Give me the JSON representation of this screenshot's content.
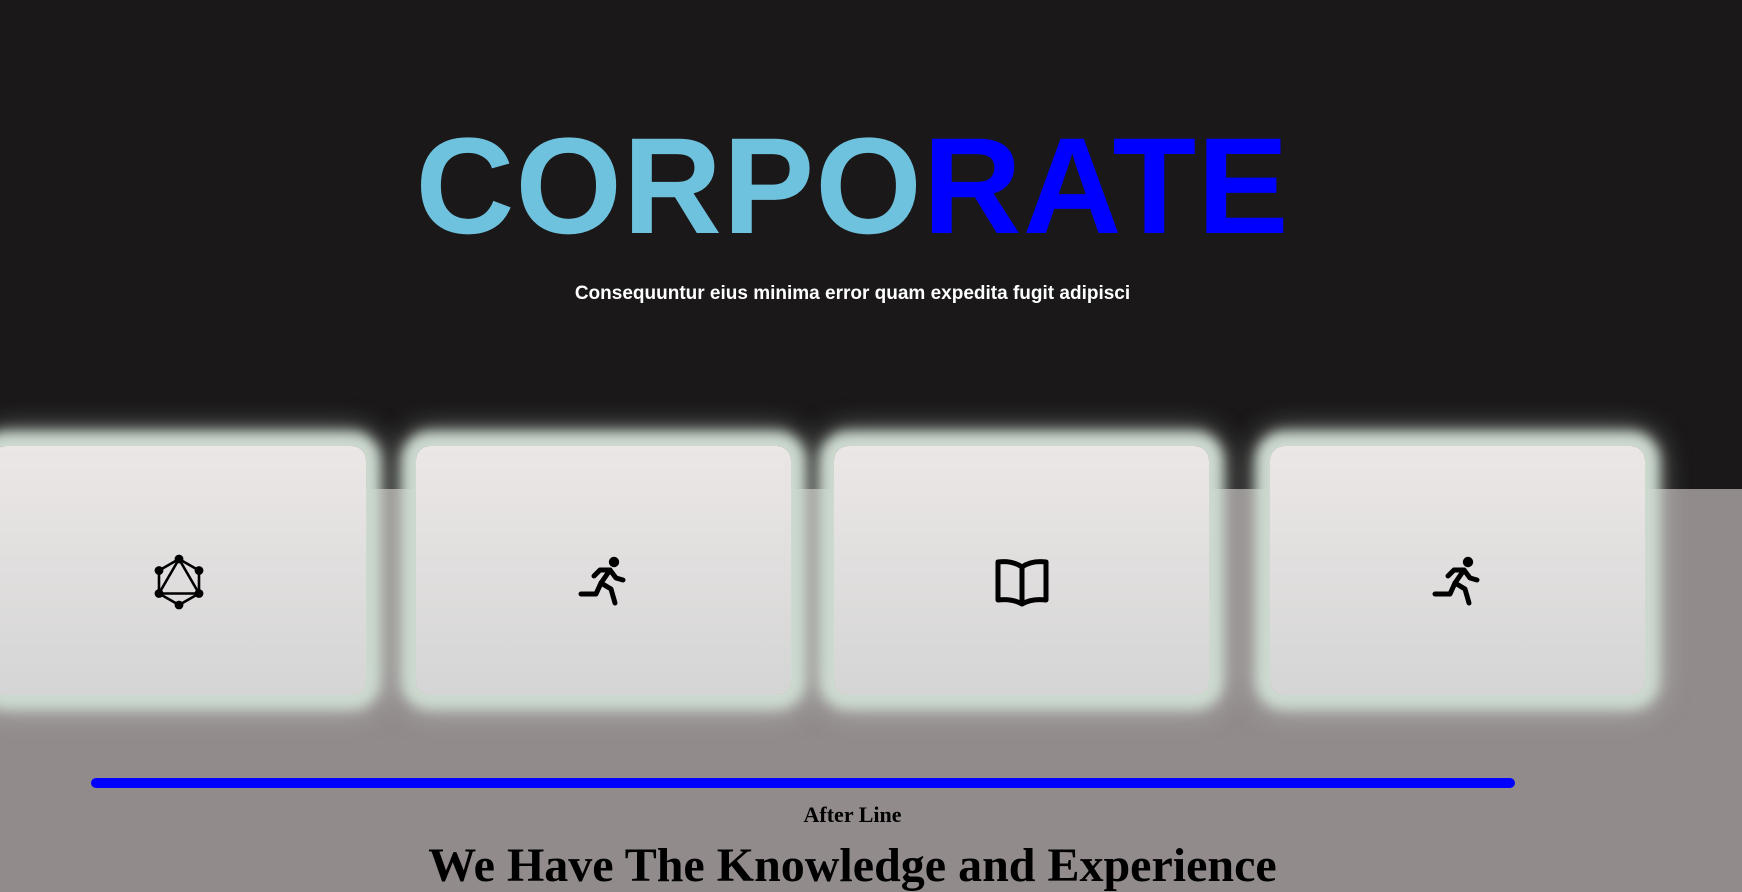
{
  "hero": {
    "brand_part_1": "CORPO",
    "brand_part_2": "RATE",
    "tagline": "Consequuntur eius minima error quam expedita fugit adipisci",
    "brand_color_1": "#6fc2dd",
    "brand_color_2": "#0000ff",
    "background_color": "#1a1819"
  },
  "cards": [
    {
      "icon": "graphql-icon"
    },
    {
      "icon": "running-person-icon"
    },
    {
      "icon": "open-book-icon"
    },
    {
      "icon": "running-person-icon"
    }
  ],
  "section": {
    "after_line": "After Line",
    "heading": "We Have The Knowledge and Experience",
    "divider_color": "#0000ff",
    "background_color": "#928b8c"
  }
}
